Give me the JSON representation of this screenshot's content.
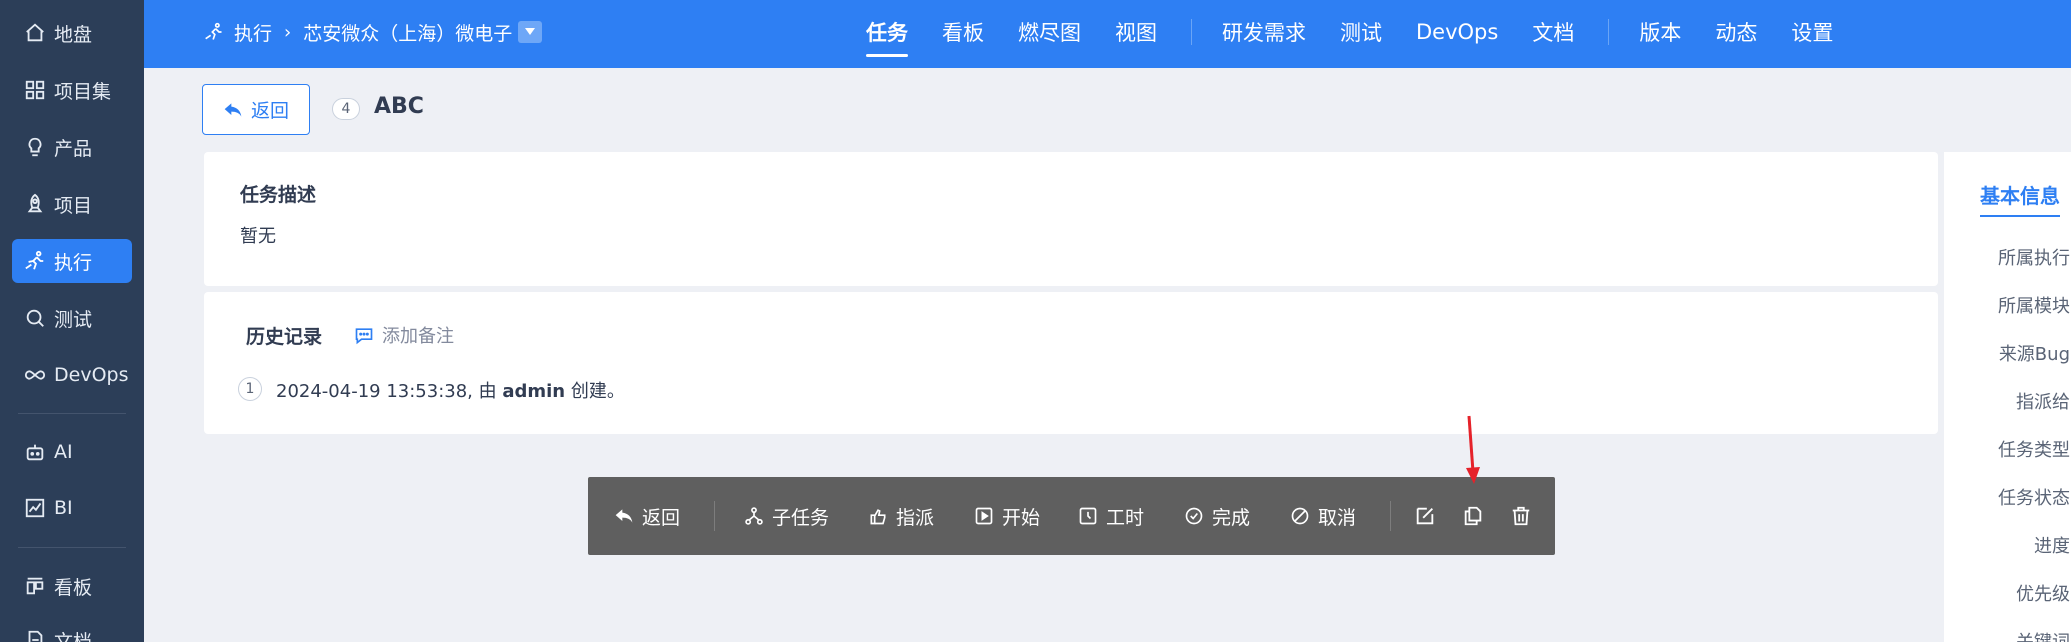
{
  "sidebar": {
    "items": [
      {
        "label": "地盘",
        "icon": "home-icon"
      },
      {
        "label": "项目集",
        "icon": "grid-icon"
      },
      {
        "label": "产品",
        "icon": "bulb-icon"
      },
      {
        "label": "项目",
        "icon": "rocket-icon"
      },
      {
        "label": "执行",
        "icon": "run-icon",
        "active": true
      },
      {
        "label": "测试",
        "icon": "search-test-icon"
      },
      {
        "label": "DevOps",
        "icon": "infinity-icon"
      },
      {
        "label": "AI",
        "icon": "robot-icon"
      },
      {
        "label": "BI",
        "icon": "chart-icon"
      },
      {
        "label": "看板",
        "icon": "kanban-icon"
      },
      {
        "label": "文档",
        "icon": "doc-icon"
      }
    ]
  },
  "header": {
    "breadcrumb": {
      "module": "执行",
      "separator": "›",
      "project": "芯安微众（上海）微电子"
    },
    "tabs": [
      "任务",
      "看板",
      "燃尽图",
      "视图",
      "研发需求",
      "测试",
      "DevOps",
      "文档",
      "版本",
      "动态",
      "设置"
    ],
    "active_tab": "任务"
  },
  "main": {
    "back_label": "返回",
    "task_id": "4",
    "task_title": "ABC",
    "description": {
      "title": "任务描述",
      "content": "暂无"
    },
    "history": {
      "title": "历史记录",
      "add_note": "添加备注",
      "entries": [
        {
          "num": "1",
          "prefix": "2024-04-19 13:53:38, 由 ",
          "user": "admin",
          "suffix": " 创建。"
        }
      ]
    }
  },
  "right_panel": {
    "title": "基本信息",
    "fields": [
      "所属执行",
      "所属模块",
      "来源Bug",
      "指派给",
      "任务类型",
      "任务状态",
      "进度",
      "优先级",
      "关键词"
    ]
  },
  "toolbar": {
    "back": "返回",
    "subtask": "子任务",
    "assign": "指派",
    "start": "开始",
    "effort": "工时",
    "finish": "完成",
    "cancel": "取消"
  },
  "colors": {
    "primary": "#2e7ff3",
    "sidebar": "#2c3e58",
    "toolbar": "#5f5f5f",
    "annotation_arrow": "#e5222a"
  }
}
